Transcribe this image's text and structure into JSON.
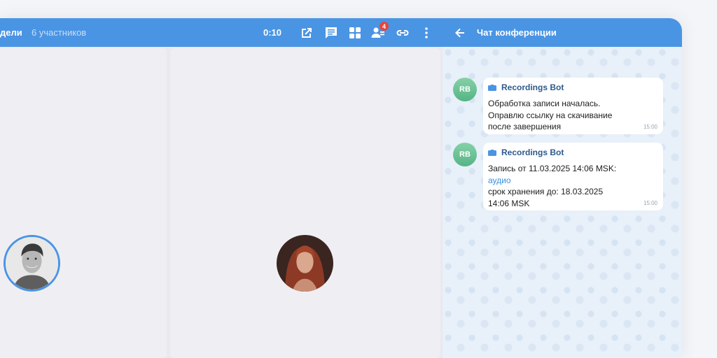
{
  "header": {
    "title": "дели",
    "participants": "6 участников",
    "timer": "0:10",
    "participants_badge": "4",
    "chat_title": "Чат конференции",
    "accent_color": "#4a94e4"
  },
  "icons": {
    "toolbar": [
      "external-link-icon",
      "chat-icon",
      "grid-layout-icon",
      "participants-icon",
      "link-icon",
      "more-vertical-icon"
    ],
    "chat": [
      "back-arrow-icon"
    ]
  },
  "participants": [
    {
      "name": "participant-man",
      "speaking": true
    },
    {
      "name": "participant-woman",
      "speaking": false
    }
  ],
  "chat": {
    "messages": [
      {
        "avatar": "RB",
        "sender": "Recordings Bot",
        "lines": [
          "Обработка записи началась.",
          "Оправлю ссылку на скачивание",
          "после завершения"
        ],
        "time": "15:00"
      },
      {
        "avatar": "RB",
        "sender": "Recordings Bot",
        "line1": "Запись от 11.03.2025 14:06 MSK:",
        "link": "аудио",
        "line3": "срок хранения до: 18.03.2025",
        "line4": "14:06 MSK",
        "time": "15:00"
      }
    ]
  }
}
